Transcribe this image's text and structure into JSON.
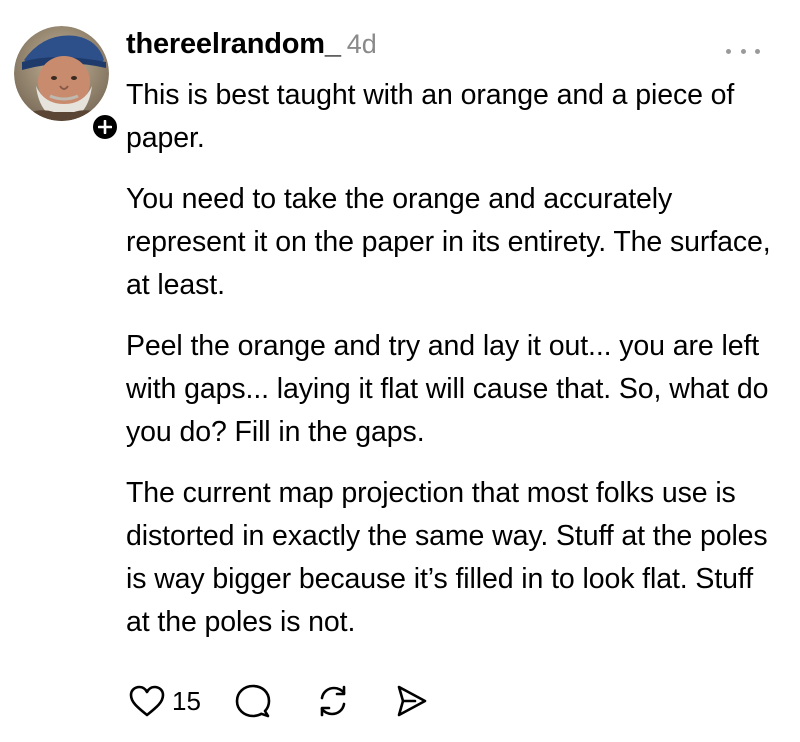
{
  "post": {
    "username": "thereelrandom_",
    "timestamp": "4d",
    "paragraphs": [
      "This is best taught with an orange and a piece of paper.",
      "You need to take the orange and accurately represent it on the paper in its entirety. The surface, at least.",
      "Peel the orange and try and lay it out... you are left with gaps... laying it flat will cause that. So, what do you do? Fill in the gaps.",
      "The  current map projection that most folks use is distorted in exactly the same way. Stuff at the poles is way bigger because it’s filled in to look flat. Stuff at the poles is not."
    ],
    "follow_badge": "+",
    "like_count": "15"
  },
  "icons": {
    "more": "more-horizontal-icon",
    "like": "heart-icon",
    "reply": "comment-icon",
    "repost": "repost-icon",
    "share": "send-icon",
    "follow": "plus-icon"
  },
  "colors": {
    "text": "#000000",
    "muted": "#8a8a8a",
    "background": "#ffffff"
  }
}
